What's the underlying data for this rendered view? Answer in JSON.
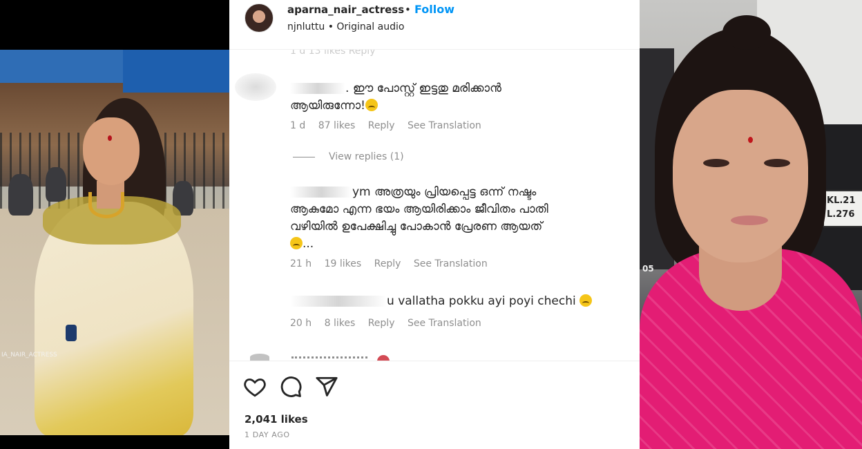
{
  "post": {
    "username": "aparna_nair_actress",
    "separator": "•",
    "follow_label": "Follow",
    "audio_line": "njnluttu • Original audio",
    "likes": "2,041 likes",
    "time_ago": "1 DAY AGO"
  },
  "left_photo": {
    "watermark": "IA_NAIR_ACTRESS"
  },
  "right_photo": {
    "plate_line1": "KL.21",
    "plate_line2": "L.276",
    "side_mark": "05"
  },
  "comments": {
    "faded_meta": "1 d    13 likes    Reply",
    "items": [
      {
        "text_line1": "ഈ പോസ്റ്റ് ഇട്ടതു മരിക്കാൻ",
        "text_line2": "ആയിരുന്നോ!",
        "age": "1 d",
        "likes": "87 likes",
        "reply": "Reply",
        "translate": "See Translation",
        "view_replies": "View replies (1)"
      },
      {
        "name_fragment": "ym",
        "text_line1": "അത്രയും പ്രിയപ്പെട്ട ഒന്ന് നഷ്ടം",
        "text_line2": "ആകുമോ എന്ന ഭയം ആയിരിക്കാം ജീവിതം പാതി",
        "text_line3": "വഴിയിൽ ഉപേക്ഷിച്ചു പോകാൻ പ്രേരണ ആയത്",
        "text_line4": "...",
        "age": "21 h",
        "likes": "19 likes",
        "reply": "Reply",
        "translate": "See Translation"
      },
      {
        "name_fragment": "u",
        "text_line1": "vallatha pokku ayi poyi chechi",
        "age": "20 h",
        "likes": "8 likes",
        "reply": "Reply",
        "translate": "See Translation"
      }
    ]
  },
  "icons": {
    "like": "heart-icon",
    "comment": "comment-icon",
    "share": "paper-plane-icon",
    "emoji": "sad-face-emoji-icon"
  },
  "colors": {
    "follow_blue": "#0095f6",
    "meta_gray": "#8e8e8e",
    "text_dark": "#262626"
  }
}
